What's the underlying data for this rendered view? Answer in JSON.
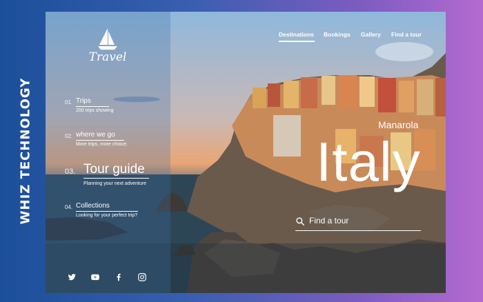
{
  "brand": {
    "vertical_text": "WHIZ TECHNOLOGY"
  },
  "logo": {
    "text": "Travel"
  },
  "nav": [
    {
      "label": "Destinations",
      "active": true
    },
    {
      "label": "Bookings"
    },
    {
      "label": "Gallery"
    },
    {
      "label": "Find a tour"
    }
  ],
  "menu": [
    {
      "num": "01.",
      "title": "Trips",
      "subtitle": "200 trips showing"
    },
    {
      "num": "02.",
      "title": "where we go",
      "subtitle": "More trips, more choice."
    },
    {
      "num": "03.",
      "title": "Tour guide",
      "subtitle": "Planning your next adventure",
      "active": true
    },
    {
      "num": "04.",
      "title": "Collections",
      "subtitle": "Looking for your perfect trip?"
    }
  ],
  "hero": {
    "subtitle": "Manarola",
    "title": "Italy"
  },
  "search": {
    "label": "Find a tour"
  },
  "social": [
    "twitter-icon",
    "youtube-icon",
    "facebook-icon",
    "instagram-icon"
  ],
  "colors": {
    "bg_left": "#1b4f9a",
    "bg_right": "#b46ad0",
    "text": "#ffffff"
  }
}
